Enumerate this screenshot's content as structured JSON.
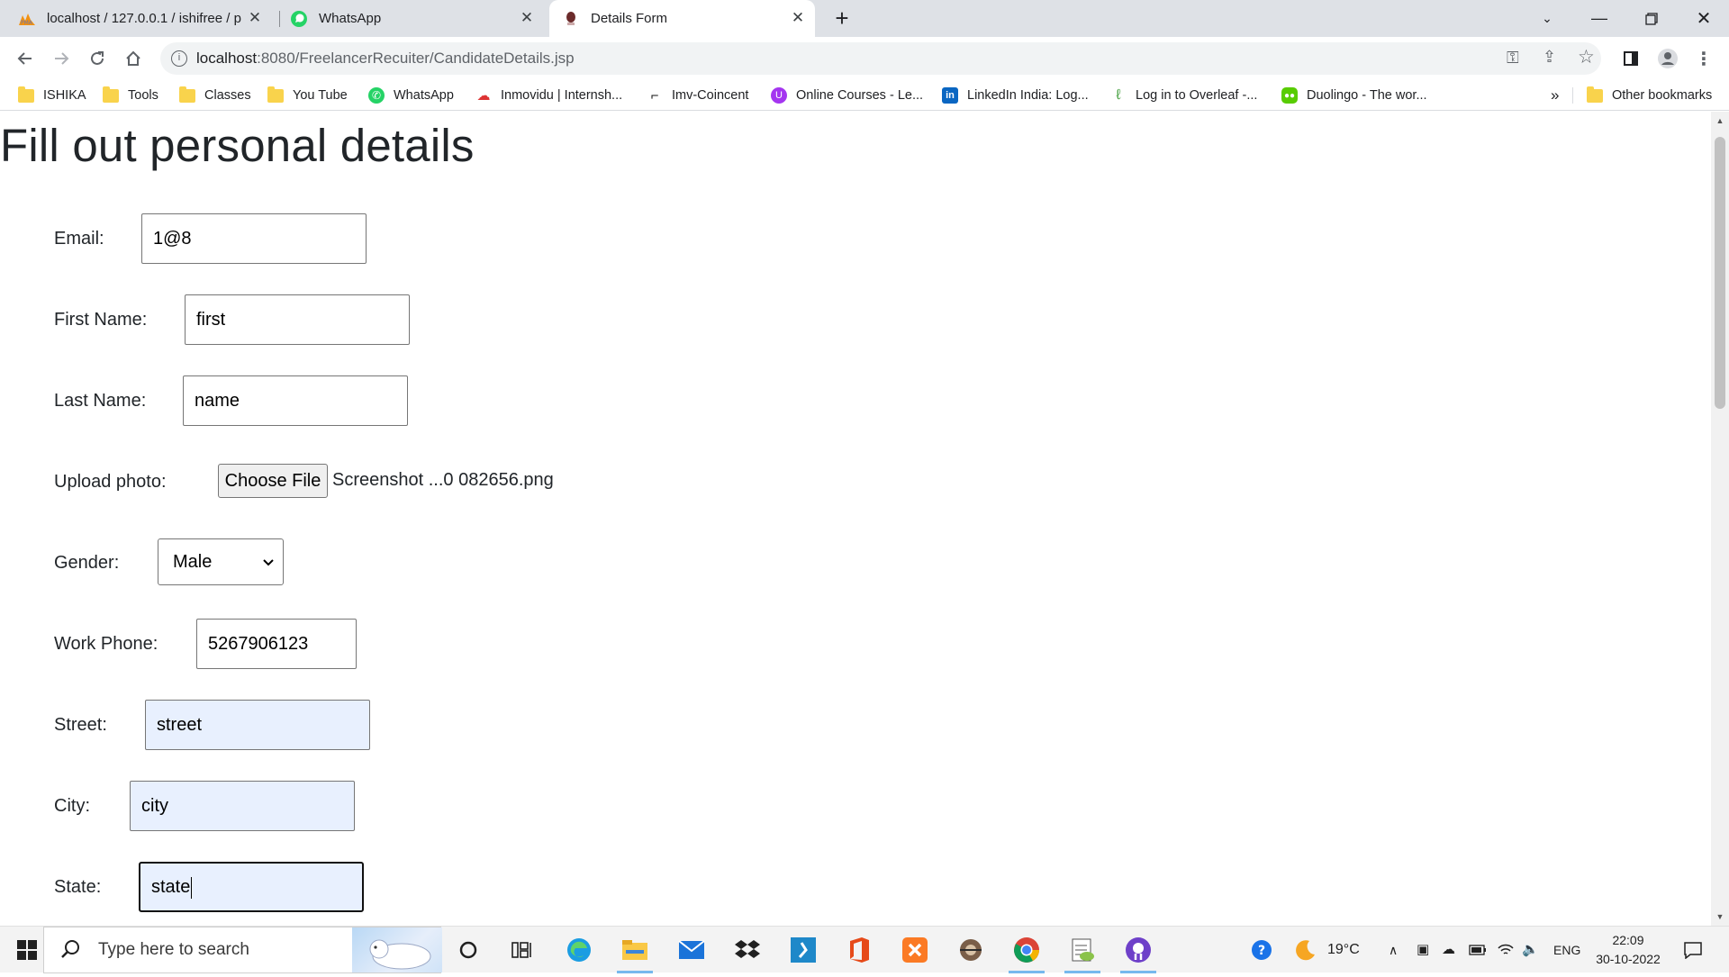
{
  "browser": {
    "tabs": [
      {
        "title": "localhost / 127.0.0.1 / ishifree / p",
        "icon": "phpmyadmin-icon"
      },
      {
        "title": "WhatsApp",
        "icon": "whatsapp-icon"
      },
      {
        "title": "Details Form",
        "icon": "page-favicon",
        "active": true
      }
    ],
    "url_host": "localhost",
    "url_path": ":8080/FreelancerRecuiter/CandidateDetails.jsp",
    "bookmarks": [
      {
        "label": "ISHIKA",
        "icon": "folder-icon"
      },
      {
        "label": "Tools",
        "icon": "folder-icon"
      },
      {
        "label": "Classes",
        "icon": "folder-icon"
      },
      {
        "label": "You Tube",
        "icon": "folder-icon"
      },
      {
        "label": "WhatsApp",
        "icon": "whatsapp-icon"
      },
      {
        "label": "Inmovidu | Internsh...",
        "icon": "inmovidu-icon"
      },
      {
        "label": "Imv-Coincent",
        "icon": "imv-icon"
      },
      {
        "label": "Online Courses - Le...",
        "icon": "udemy-icon"
      },
      {
        "label": "LinkedIn India: Log...",
        "icon": "linkedin-icon"
      },
      {
        "label": "Log in to Overleaf -...",
        "icon": "overleaf-icon"
      },
      {
        "label": "Duolingo - The wor...",
        "icon": "duolingo-icon"
      }
    ],
    "more_bookmarks": "»",
    "other_bookmarks": "Other bookmarks"
  },
  "page": {
    "title": "Fill out personal details",
    "fields": {
      "email": {
        "label": "Email:",
        "value": "1@8"
      },
      "first_name": {
        "label": "First Name:",
        "value": "first"
      },
      "last_name": {
        "label": "Last Name:",
        "value": "name"
      },
      "photo": {
        "label": "Upload photo:",
        "button": "Choose File",
        "file": "Screenshot ...0 082656.png"
      },
      "gender": {
        "label": "Gender:",
        "value": "Male"
      },
      "work_phone": {
        "label": "Work Phone:",
        "value": "5267906123"
      },
      "street": {
        "label": "Street:",
        "value": "street"
      },
      "city": {
        "label": "City:",
        "value": "city"
      },
      "state": {
        "label": "State:",
        "value": "state"
      }
    }
  },
  "taskbar": {
    "search_placeholder": "Type here to search",
    "weather": "19°C",
    "language": "ENG",
    "time": "22:09",
    "date": "30-10-2022"
  }
}
